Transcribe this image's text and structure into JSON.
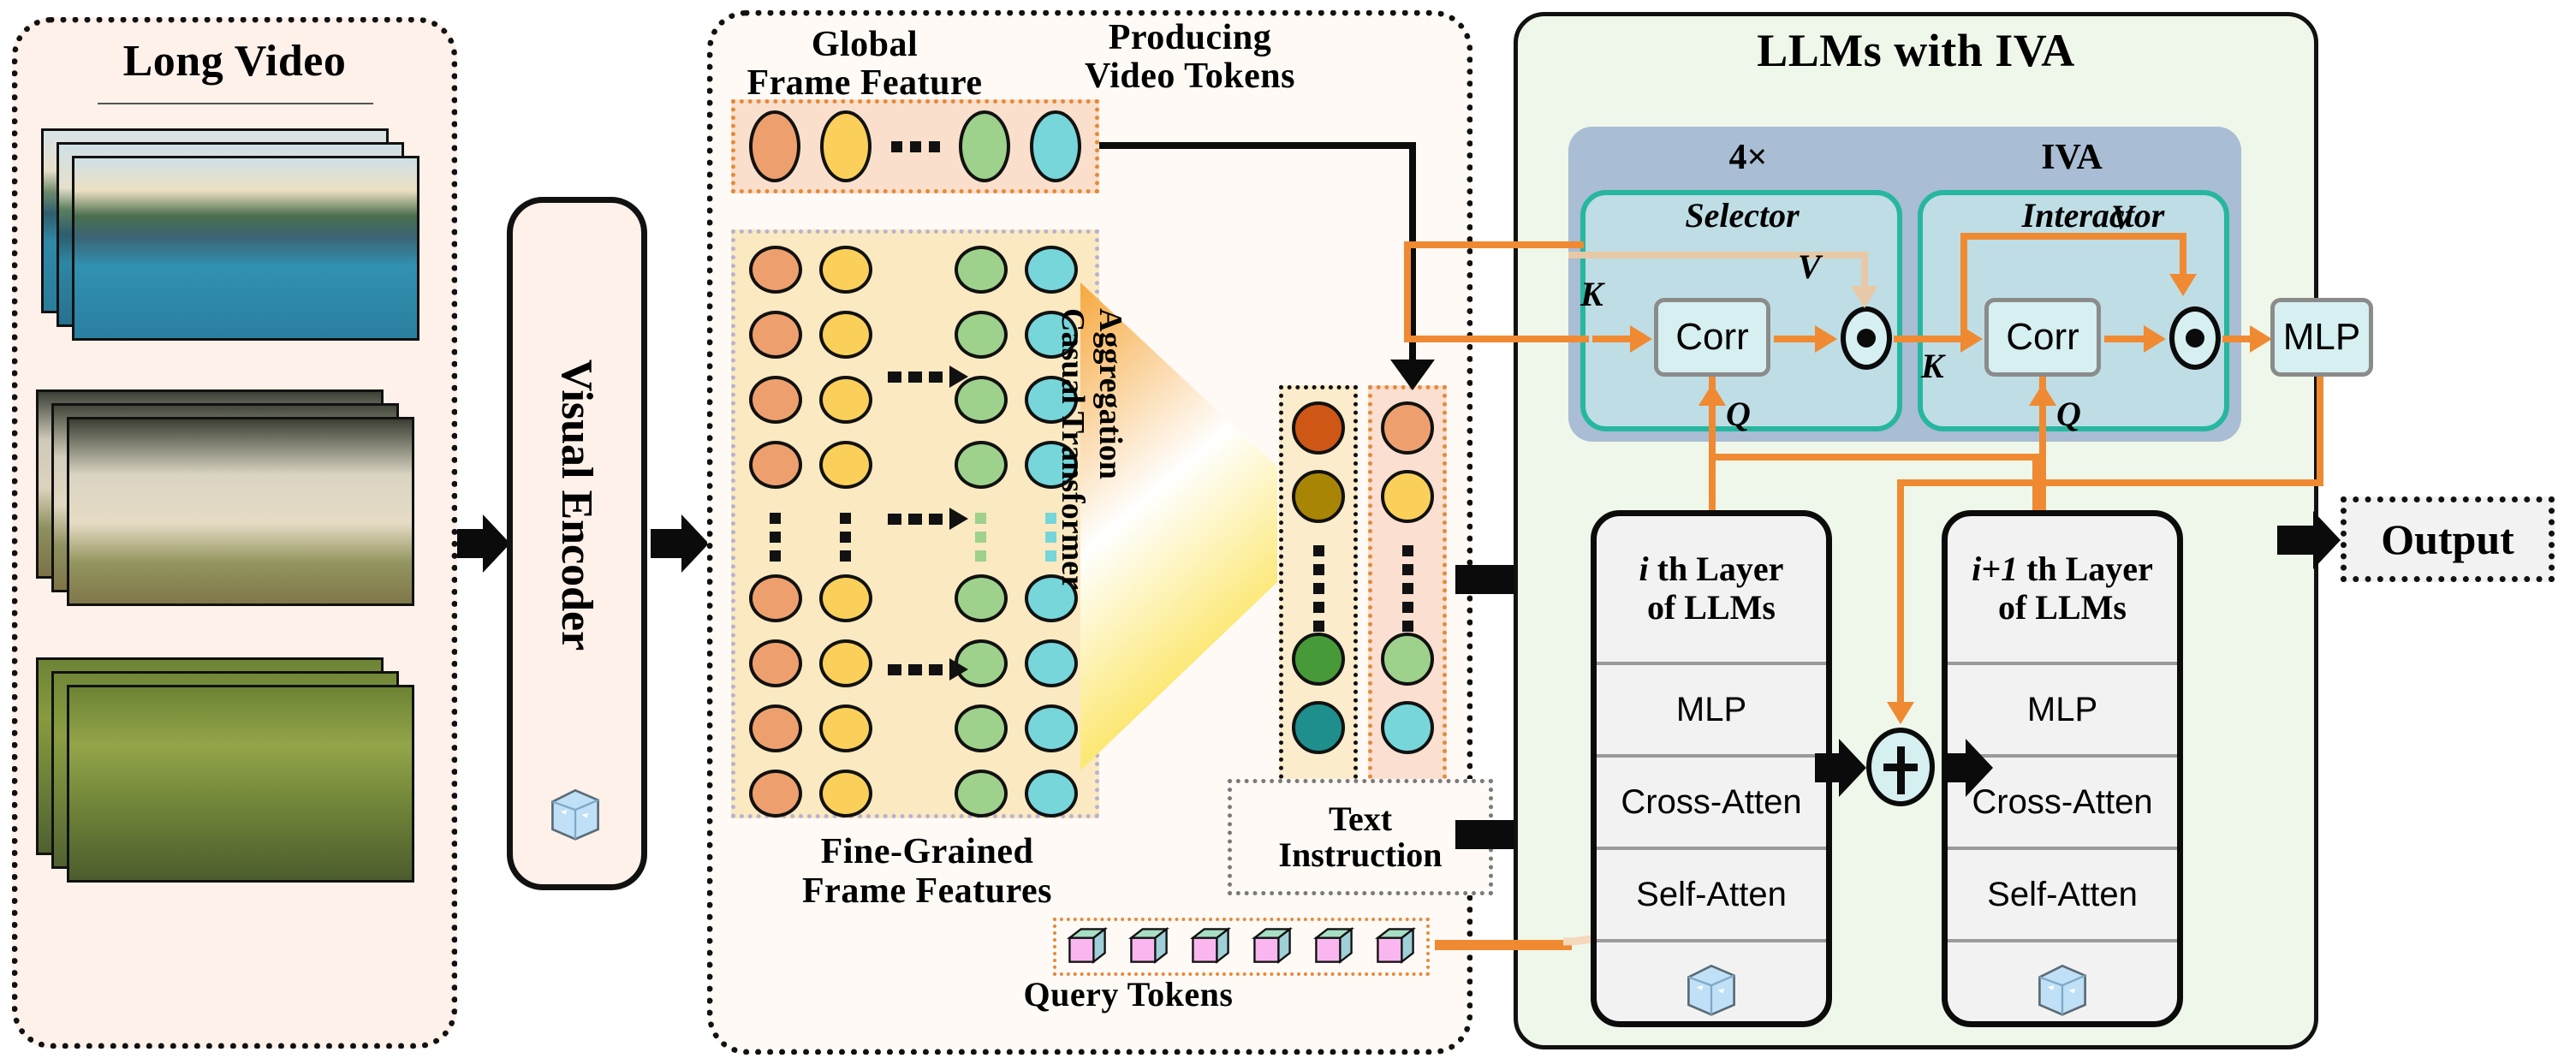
{
  "panels": {
    "video": {
      "title": "Long Video"
    },
    "tokens": {
      "global_title": "Global\nFrame Feature",
      "producing_title": "Producing\nVideo Tokens",
      "fine_title": "Fine-Grained\nFrame Features",
      "aggregation_label": "Aggregation\nCasual Transformer",
      "text_instruction": "Text\nInstruction",
      "query_tokens_label": "Query Tokens"
    },
    "llm": {
      "title": "LLMs with IVA"
    }
  },
  "encoder": {
    "label": "Visual Encoder",
    "frozen_icon": "ice-cube-icon"
  },
  "iva": {
    "repeat_label": "4×",
    "name": "IVA",
    "selector": {
      "title": "Selector",
      "corr_label": "Corr",
      "k_label": "K",
      "q_label": "Q",
      "v_label": "V",
      "product_icon": "element-wise-product-icon"
    },
    "interactor": {
      "title": "Interactor",
      "corr_label": "Corr",
      "k_label": "K",
      "q_label": "Q",
      "v_label": "V",
      "mlp_label": "MLP",
      "product_icon": "element-wise-product-icon"
    }
  },
  "llm_layers": [
    {
      "title": "i th Layer\nof LLMs",
      "title_prefix": "i",
      "title_rest": " th Layer",
      "title_line2": "of LLMs",
      "rows": [
        "MLP",
        "Cross-Atten",
        "Self-Atten"
      ],
      "frozen_icon": "ice-cube-icon"
    },
    {
      "title": "i+1 th Layer\nof LLMs",
      "title_prefix": "i+1",
      "title_rest": " th Layer",
      "title_line2": "of LLMs",
      "rows": [
        "MLP",
        "Cross-Atten",
        "Self-Atten"
      ],
      "frozen_icon": "ice-cube-icon"
    }
  ],
  "add_node": {
    "symbol": "+",
    "name": "residual-add-icon"
  },
  "output": {
    "label": "Output"
  },
  "colors": {
    "video_panel_bg": "#fdf1ea",
    "tokens_panel_bg": "#fffaf6",
    "llm_panel_bg": "#eef7e9",
    "global_strip_bg": "#fae0cc",
    "global_strip_border": "#e58a3a",
    "fine_grid_bg": "#fbe9c2",
    "fine_grid_border": "#b9b2cf",
    "token_dark_col_bg": "#fbeccb",
    "token_light_col_bg": "#fbdfd0",
    "iva_outer_bg": "#a9bdd4",
    "iva_inner_bg": "#bfdde4",
    "iva_inner_border": "#27b6a0",
    "orange_line": "#ef8a33",
    "pale_orange_line": "#e7c9a8",
    "corr_bg": "#d6eff1",
    "llm_box_bg": "#f2f2f2",
    "feature_orange": "#eda06e",
    "feature_yellow": "#fad05a",
    "feature_green": "#9ed18c",
    "feature_cyan": "#76d6da",
    "token_dark_orange": "#cf5715",
    "token_dark_yellow": "#a88505",
    "token_dark_green": "#479a38",
    "token_dark_teal": "#1f8f8d",
    "query_cube_face": "#f9b6ef",
    "query_cube_top": "#a7dfc4"
  },
  "features": {
    "global_row_colors": [
      "#eda06e",
      "#fad05a",
      "#9ed18c",
      "#76d6da"
    ],
    "fine_col_colors": [
      "#eda06e",
      "#fad05a",
      "#9ed18c",
      "#76d6da"
    ],
    "fine_rows": 9,
    "token_col_dark_colors": [
      "#cf5715",
      "#a88505",
      "#479a38",
      "#1f8f8d"
    ],
    "token_col_light_colors": [
      "#eda06e",
      "#fad05a",
      "#9ed18c",
      "#76d6da"
    ],
    "query_token_count": 6,
    "ellipsis_glyph": "...."
  }
}
